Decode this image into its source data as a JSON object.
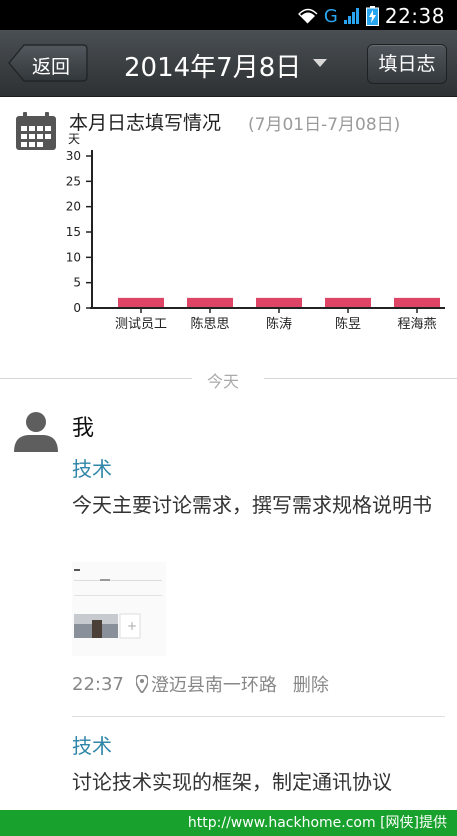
{
  "status_bar": {
    "network": "G",
    "time": "22:38"
  },
  "header": {
    "back_label": "返回",
    "date_title": "2014年7月8日",
    "fill_label": "填日志"
  },
  "summary": {
    "title": "本月日志填写情况",
    "range": "(7月01日-7月08日)"
  },
  "chart_data": {
    "type": "bar",
    "title": "",
    "ylabel": "天",
    "categories": [
      "测试员工",
      "陈思思",
      "陈涛",
      "陈昱",
      "程海燕"
    ],
    "values": [
      2,
      2,
      2,
      2,
      2
    ],
    "ylim": [
      0,
      30
    ],
    "yticks": [
      0,
      5,
      10,
      15,
      20,
      25,
      30
    ],
    "bar_color": "#dd4466",
    "grid": false
  },
  "divider": {
    "label": "今天"
  },
  "feed": {
    "author": "我",
    "entries": [
      {
        "tag": "技术",
        "content": "今天主要讨论需求，撰写需求规格说明书",
        "time": "22:37",
        "location": "澄迈县南一环路",
        "delete_label": "删除"
      },
      {
        "tag": "技术",
        "content": "讨论技术实现的框架，制定通讯协议"
      }
    ]
  },
  "watermark": {
    "text": "http://www.hackhome.com [网侠]提供"
  }
}
